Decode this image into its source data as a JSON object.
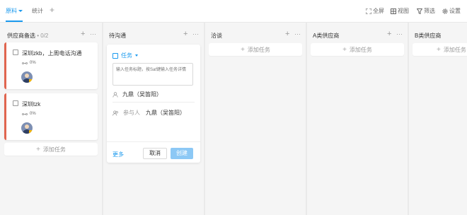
{
  "topbar": {
    "tabs": [
      {
        "label": "原料"
      },
      {
        "label": "统计"
      }
    ],
    "tools": {
      "fullscreen": "全屏",
      "view": "视图",
      "filter": "筛选",
      "settings": "设置"
    }
  },
  "columns": [
    {
      "title": "供应商备选",
      "count": "• 0/2"
    },
    {
      "title": "待沟通",
      "count": ""
    },
    {
      "title": "洽谈",
      "count": ""
    },
    {
      "title": "A类供应商",
      "count": ""
    },
    {
      "title": "B类供应商",
      "count": ""
    }
  ],
  "cards": [
    {
      "title": "深圳zkb，上周电话沟通",
      "progress": "0%"
    },
    {
      "title": "深圳tzk",
      "progress": "0%"
    }
  ],
  "add_task_label": "添加任务",
  "form": {
    "type_label": "任务",
    "placeholder": "输入任务标题，按Sat键输入任务详情",
    "assignee": "九鼎（吴笛阳）",
    "participants_label": "参与人",
    "participants": "九鼎（吴笛阳）",
    "more": "更多",
    "cancel": "取消",
    "create": "创建"
  },
  "colors": {
    "accent": "#1b9aee",
    "priority_bar": "#e0654f",
    "create_disabled": "#8cc8f5"
  }
}
